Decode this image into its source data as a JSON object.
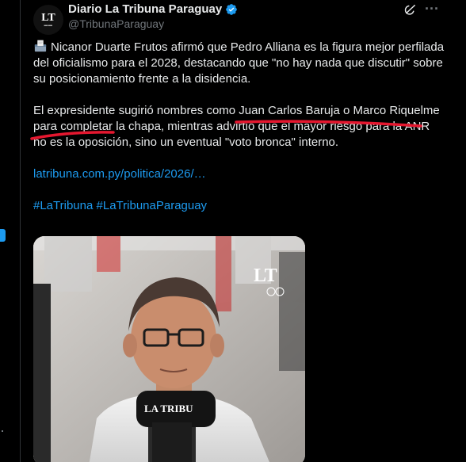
{
  "account": {
    "name": "Diario La Tribuna Paraguay",
    "handle": "@TribunaParaguay",
    "avatar_text": "LT"
  },
  "icons": {
    "verified": "verified-badge-icon",
    "grok": "grok-icon",
    "more": "more-icon",
    "ballot": "ballot-box-emoji"
  },
  "tweet": {
    "paragraph1": "Nicanor Duarte Frutos afirmó que Pedro Alliana es la figura mejor perfilada del oficialismo para el 2028, destacando que \"no hay nada que discutir\" sobre su posicionamiento frente a la disidencia.",
    "paragraph2": "El expresidente sugirió nombres como Juan Carlos Baruja o Marco Riquelme para completar la chapa, mientras advirtió que el mayor riesgo para la ANR no es la oposición, sino un eventual \"voto bronca\" interno.",
    "link": "latribuna.com.py/politica/2026/…",
    "hashtag1": "#LaTribuna",
    "hashtag2": "#LaTribunaParaguay"
  },
  "media": {
    "watermark": "LT",
    "mic_label": "LA TRIBU"
  },
  "colors": {
    "background": "#000000",
    "text": "#e7e9ea",
    "muted": "#71767b",
    "link": "#1d9bf0",
    "annotation": "#e5172f"
  }
}
